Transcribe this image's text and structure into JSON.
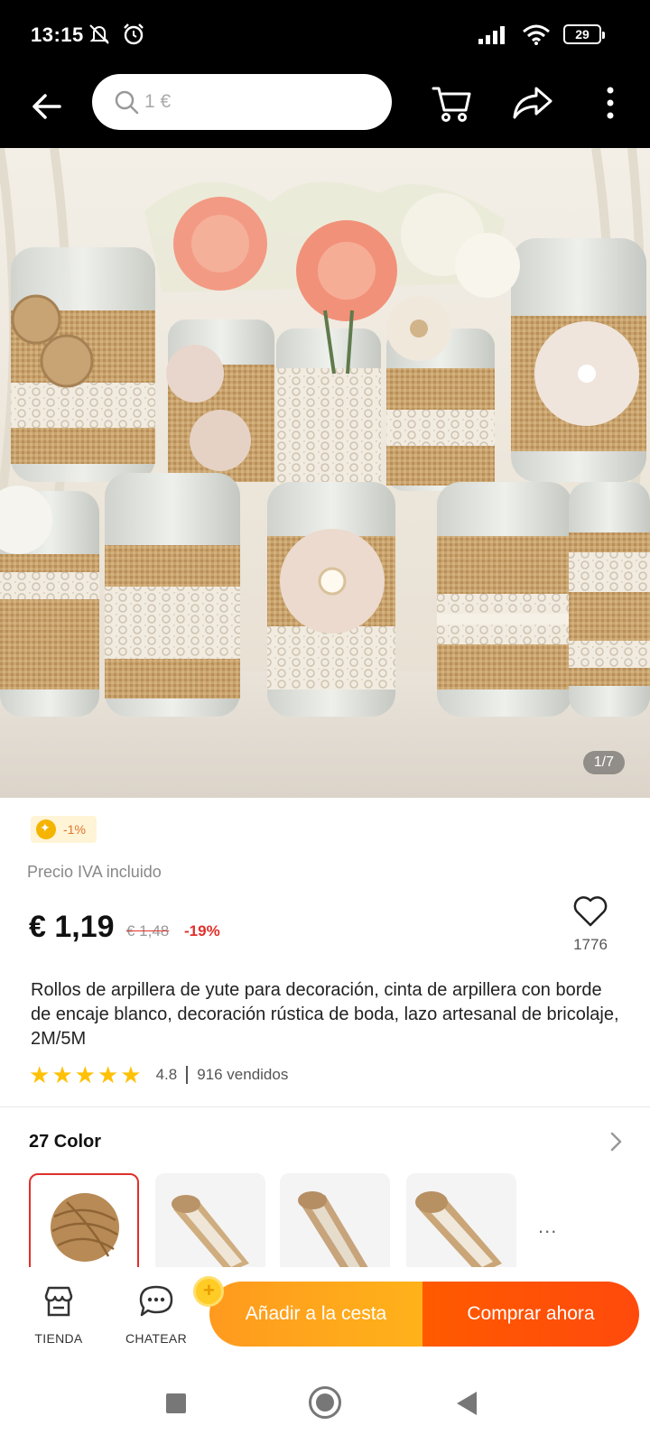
{
  "status_bar": {
    "time": "13:15",
    "battery": "29",
    "icons": [
      "mute-icon",
      "alarm-icon",
      "signal-icon",
      "wifi-icon",
      "battery-icon"
    ]
  },
  "header": {
    "search_placeholder": "1 €",
    "icons": [
      "back-arrow-icon",
      "search-icon",
      "cart-icon",
      "share-icon",
      "more-vertical-icon"
    ]
  },
  "gallery": {
    "counter": "1/7"
  },
  "product": {
    "badge": "-1%",
    "vat_note": "Precio IVA incluido",
    "price": "€ 1,19",
    "old_price": "€ 1,48",
    "discount": "-19%",
    "wishlist_count": "1776",
    "title": "Rollos de arpillera de yute para decoración, cinta de arpillera con borde de encaje blanco, decoración rústica de boda, lazo artesanal de bricolaje, 2M/5M",
    "rating": "4.8",
    "rating_stars": 5,
    "sold": "916 vendidos"
  },
  "variants": {
    "title": "27 Color",
    "more": "..."
  },
  "bottom_bar": {
    "store_label": "TIENDA",
    "chat_label": "CHATEAR",
    "add_to_cart": "Añadir a la cesta",
    "buy_now": "Comprar ahora"
  },
  "colors": {
    "accent_red": "#e0302b",
    "cart_orange": "#ff9a1e",
    "buy_orange": "#ff4a0c",
    "star_yellow": "#ffc107"
  }
}
